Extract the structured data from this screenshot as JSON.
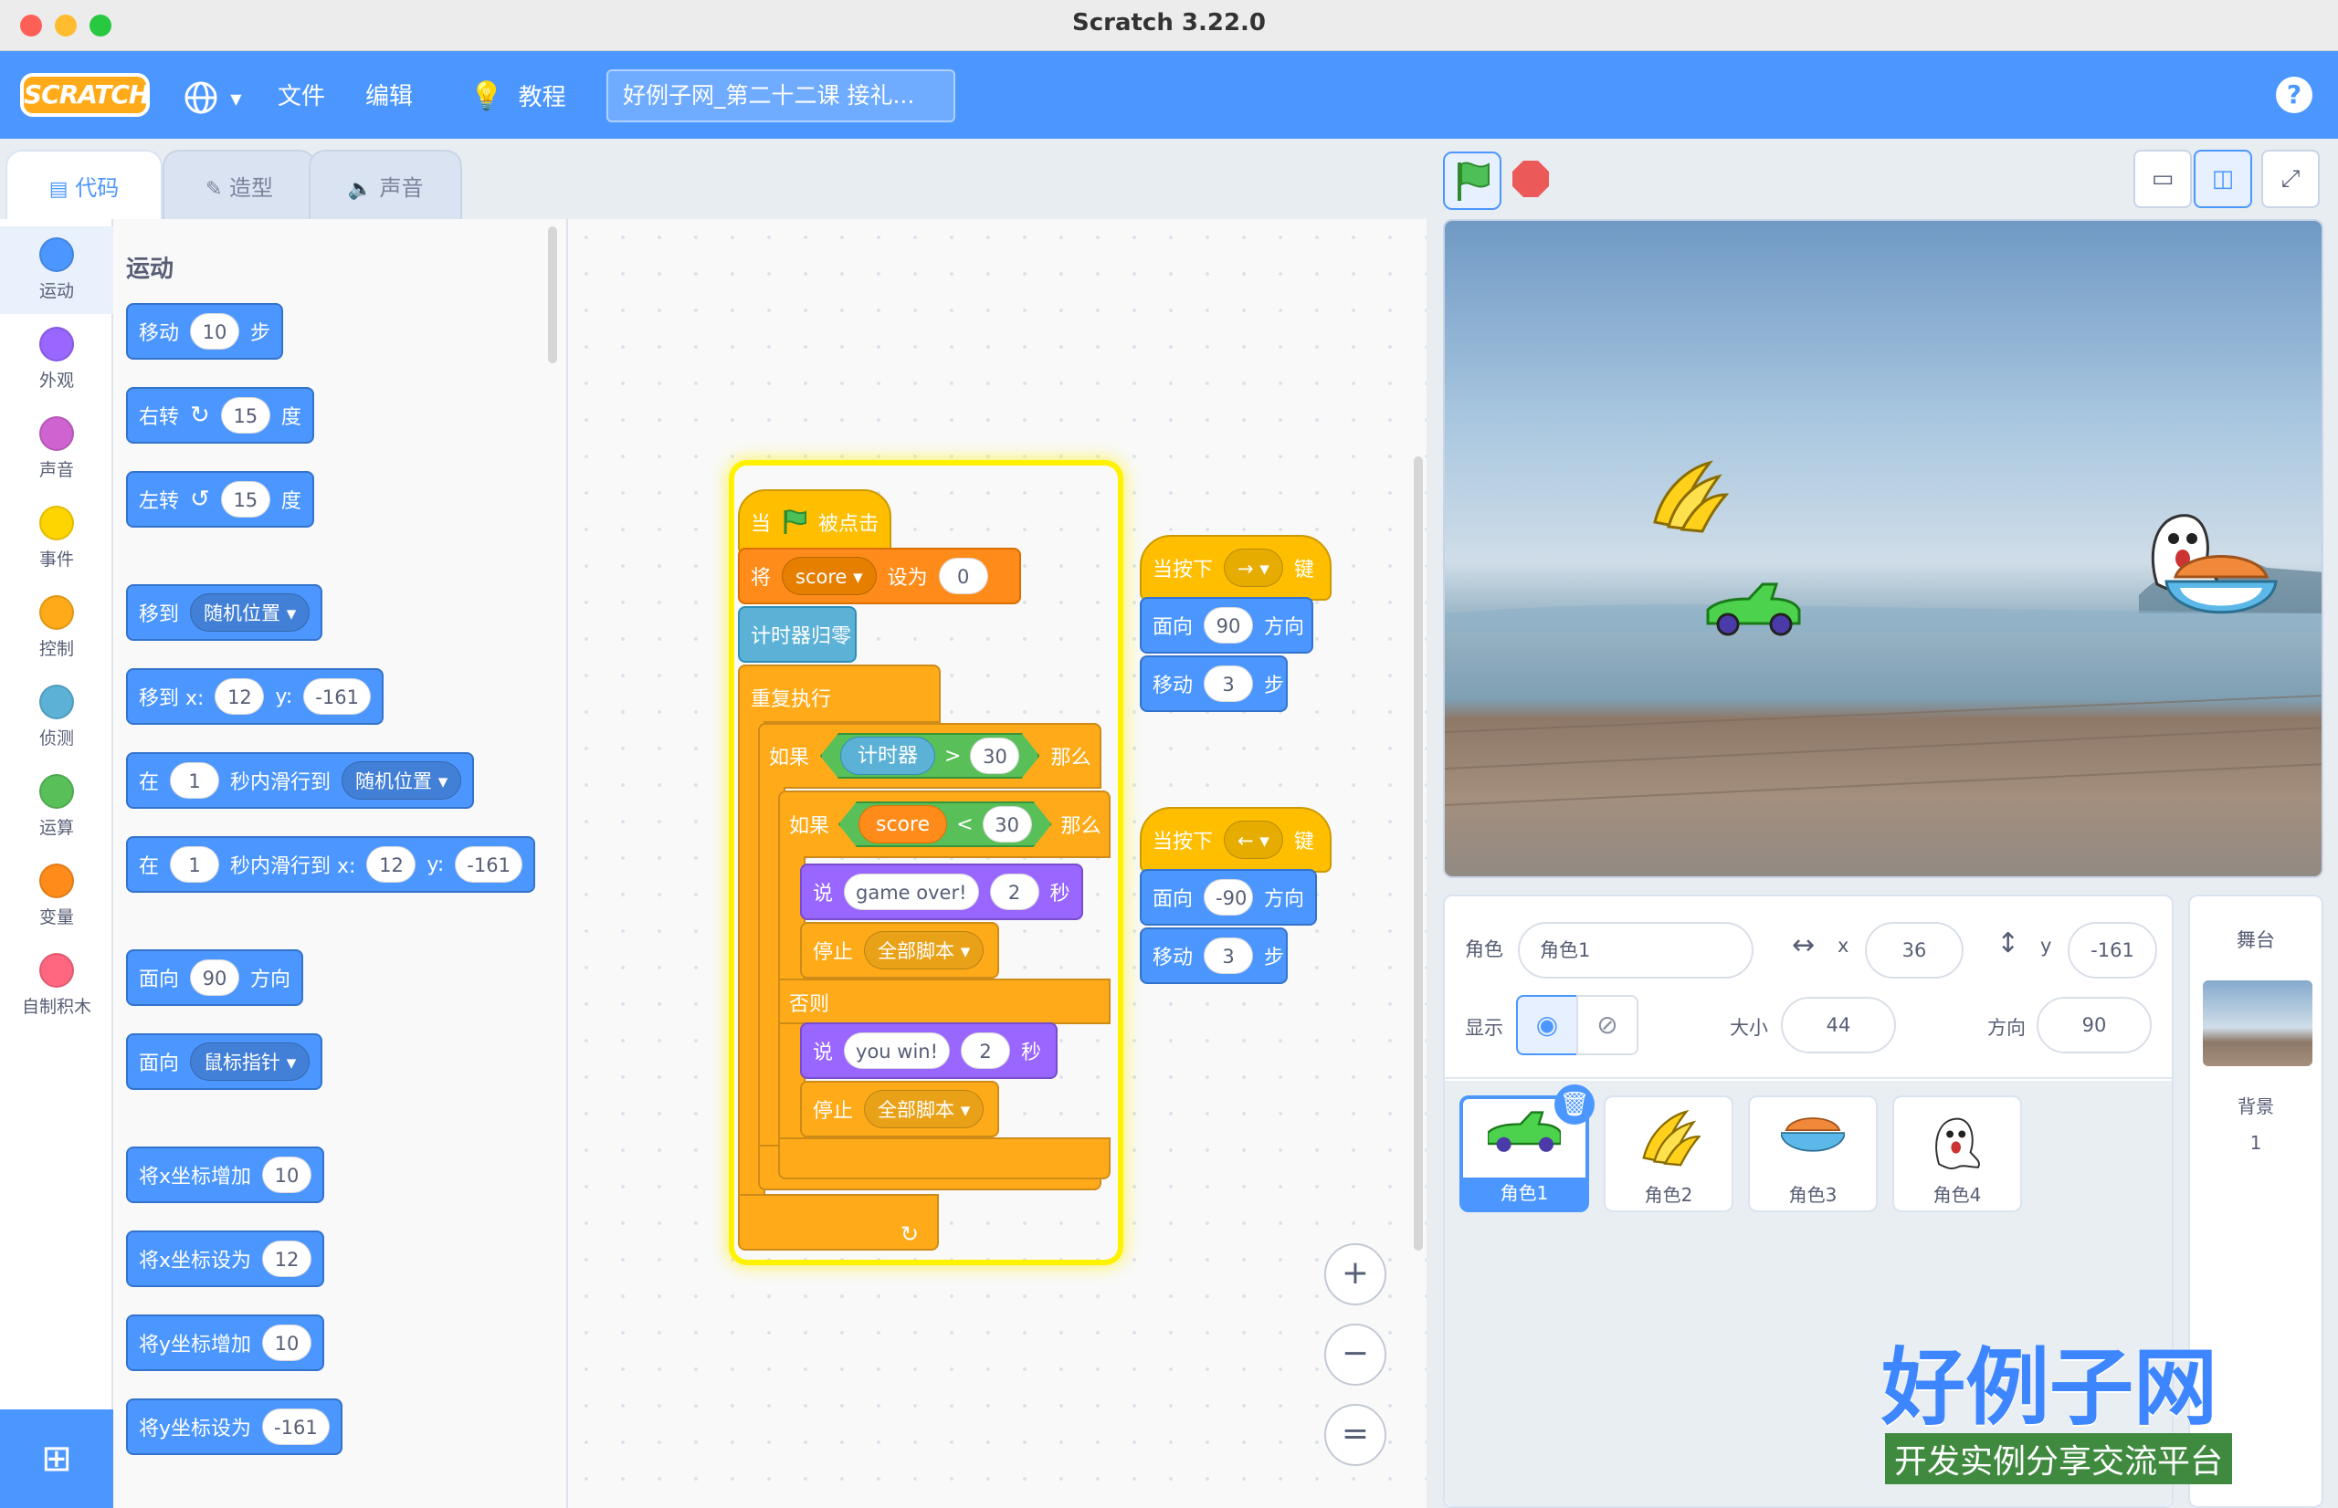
{
  "window": {
    "title": "Scratch 3.22.0"
  },
  "menu": {
    "logo": "SCRATCH",
    "file": "文件",
    "edit": "编辑",
    "tutorials": "教程",
    "project_title": "好例子网_第二十二课 接礼..."
  },
  "tabs": {
    "code": "代码",
    "costumes": "造型",
    "sounds": "声音"
  },
  "categories": [
    {
      "label": "运动",
      "color": "#4c97ff"
    },
    {
      "label": "外观",
      "color": "#9966ff"
    },
    {
      "label": "声音",
      "color": "#cf63cf"
    },
    {
      "label": "事件",
      "color": "#ffd500"
    },
    {
      "label": "控制",
      "color": "#ffab19"
    },
    {
      "label": "侦测",
      "color": "#5cb1d6"
    },
    {
      "label": "运算",
      "color": "#59c059"
    },
    {
      "label": "变量",
      "color": "#ff8c1a"
    },
    {
      "label": "自制积木",
      "color": "#ff6680"
    }
  ],
  "palette": {
    "heading": "运动",
    "move": {
      "a": "移动",
      "n": "10",
      "b": "步"
    },
    "turn_right": {
      "a": "右转",
      "n": "15",
      "b": "度"
    },
    "turn_left": {
      "a": "左转",
      "n": "15",
      "b": "度"
    },
    "goto": {
      "a": "移到",
      "dd": "随机位置"
    },
    "goto_xy": {
      "a": "移到 x:",
      "x": "12",
      "ylabel": "y:",
      "y": "-161"
    },
    "glide": {
      "a": "在",
      "n": "1",
      "b": "秒内滑行到",
      "dd": "随机位置"
    },
    "glide_xy": {
      "a": "在",
      "n": "1",
      "b": "秒内滑行到 x:",
      "x": "12",
      "ylabel": "y:",
      "y": "-161"
    },
    "point_dir": {
      "a": "面向",
      "n": "90",
      "b": "方向"
    },
    "point_towards": {
      "a": "面向",
      "dd": "鼠标指针"
    },
    "change_x": {
      "a": "将x坐标增加",
      "n": "10"
    },
    "set_x": {
      "a": "将x坐标设为",
      "n": "12"
    },
    "change_y": {
      "a": "将y坐标增加",
      "n": "10"
    },
    "set_y": {
      "a": "将y坐标设为",
      "n": "-161"
    }
  },
  "script_main": {
    "hat": {
      "a": "当",
      "b": "被点击"
    },
    "set_var": {
      "a": "将",
      "var": "score",
      "b": "设为",
      "n": "0"
    },
    "reset_timer": "计时器归零",
    "forever": "重复执行",
    "if1": {
      "a": "如果",
      "rep": "计时器",
      "op": ">",
      "n": "30",
      "b": "那么"
    },
    "if2": {
      "a": "如果",
      "rep": "score",
      "op": "<",
      "n": "30",
      "b": "那么"
    },
    "say1": {
      "a": "说",
      "text": "game over!",
      "n": "2",
      "b": "秒"
    },
    "stop1": {
      "a": "停止",
      "dd": "全部脚本"
    },
    "else": "否则",
    "say2": {
      "a": "说",
      "text": "you win!",
      "n": "2",
      "b": "秒"
    },
    "stop2": {
      "a": "停止",
      "dd": "全部脚本"
    },
    "forever_arrow": "↻"
  },
  "script_right": {
    "hat": {
      "a": "当按下",
      "key": "→",
      "b": "键"
    },
    "point": {
      "a": "面向",
      "n": "90",
      "b": "方向"
    },
    "move": {
      "a": "移动",
      "n": "3",
      "b": "步"
    }
  },
  "script_left": {
    "hat": {
      "a": "当按下",
      "key": "←",
      "b": "键"
    },
    "point": {
      "a": "面向",
      "n": "-90",
      "b": "方向"
    },
    "move": {
      "a": "移动",
      "n": "3",
      "b": "步"
    }
  },
  "zoom": {
    "in": "+",
    "out": "−",
    "reset": "="
  },
  "sprite_info": {
    "sprite_label": "角色",
    "sprite_name": "角色1",
    "x_label": "x",
    "x": "36",
    "y_label": "y",
    "y": "-161",
    "show_label": "显示",
    "size_label": "大小",
    "size": "44",
    "direction_label": "方向",
    "direction": "90"
  },
  "sprites": [
    {
      "name": "角色1",
      "icon": "car-icon"
    },
    {
      "name": "角色2",
      "icon": "banana-icon"
    },
    {
      "name": "角色3",
      "icon": "bowl-icon"
    },
    {
      "name": "角色4",
      "icon": "ghost-icon"
    }
  ],
  "backdrop": {
    "title": "舞台",
    "label": "背景",
    "count": "1"
  },
  "watermark": {
    "main": "好例子网",
    "sub": "开发实例分享交流平台"
  }
}
